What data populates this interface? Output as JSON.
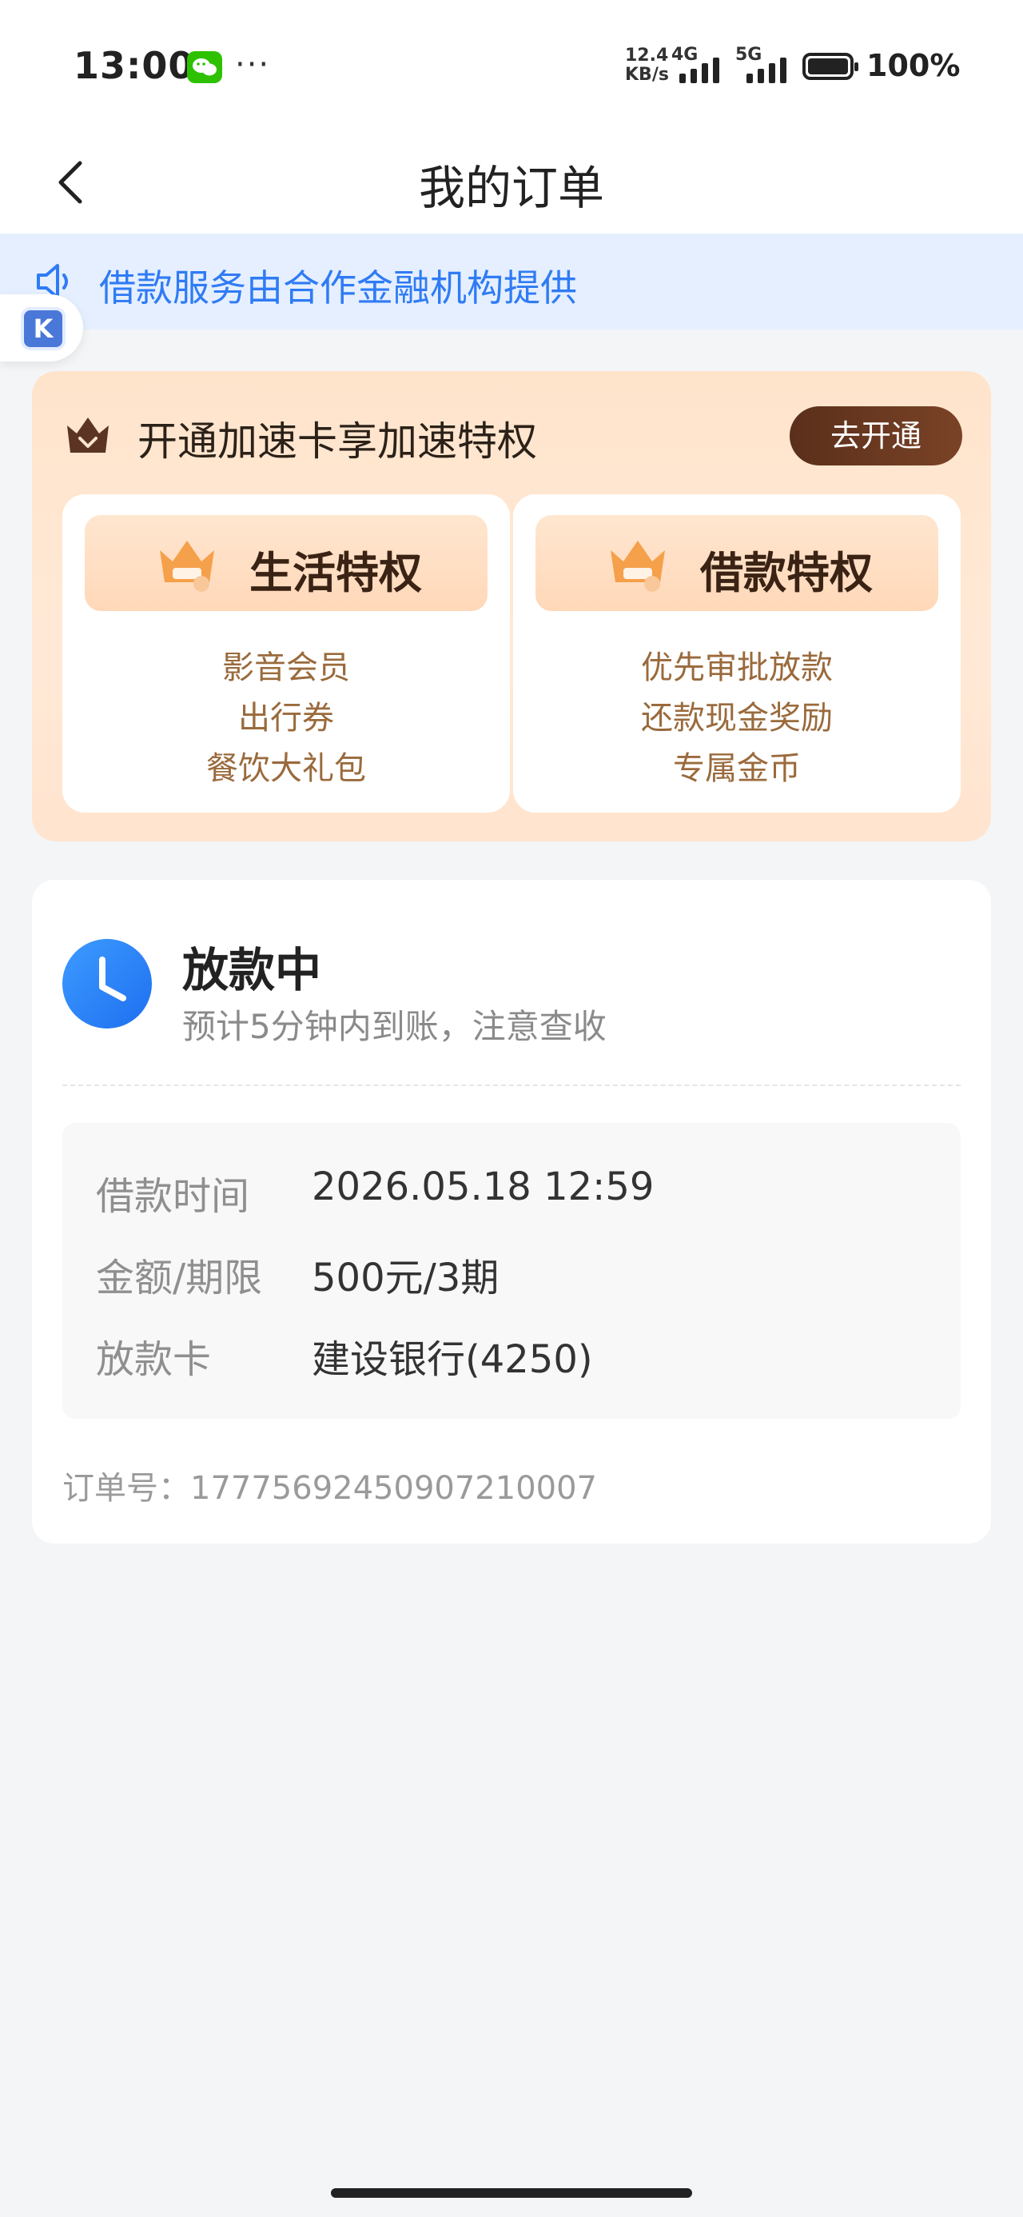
{
  "status_bar": {
    "time": "13:00",
    "more": "···",
    "speed_value": "12.4",
    "speed_unit": "KB/s",
    "net1": "4G",
    "net2": "5G",
    "battery": "100%"
  },
  "nav": {
    "title": "我的订单"
  },
  "notice": {
    "text": "借款服务由合作金融机构提供",
    "badge_letter": "K"
  },
  "promo": {
    "title": "开通加速卡享加速特权",
    "button": "去开通",
    "perks": [
      {
        "label": "生活特权",
        "items": [
          "影音会员",
          "出行券",
          "餐饮大礼包"
        ]
      },
      {
        "label": "借款特权",
        "items": [
          "优先审批放款",
          "还款现金奖励",
          "专属金币"
        ]
      }
    ]
  },
  "order": {
    "status_title": "放款中",
    "status_sub": "预计5分钟内到账，注意查收",
    "details": [
      {
        "key": "借款时间",
        "value": "2026.05.18 12:59"
      },
      {
        "key": "金额/期限",
        "value": "500元/3期"
      },
      {
        "key": "放款卡",
        "value": "建设银行(4250)"
      }
    ],
    "order_no_label": "订单号：",
    "order_no": "1777569245090721000​7"
  },
  "colors": {
    "accent_blue": "#2f7bf5",
    "promo_bg": "#ffe4cc",
    "promo_button": "#5a2f1b",
    "perk_text": "#9a6a3c"
  },
  "icons": {
    "back": "chevron-left-icon",
    "notice": "speaker-icon",
    "promo": "crown-icon",
    "status": "clock-icon"
  }
}
